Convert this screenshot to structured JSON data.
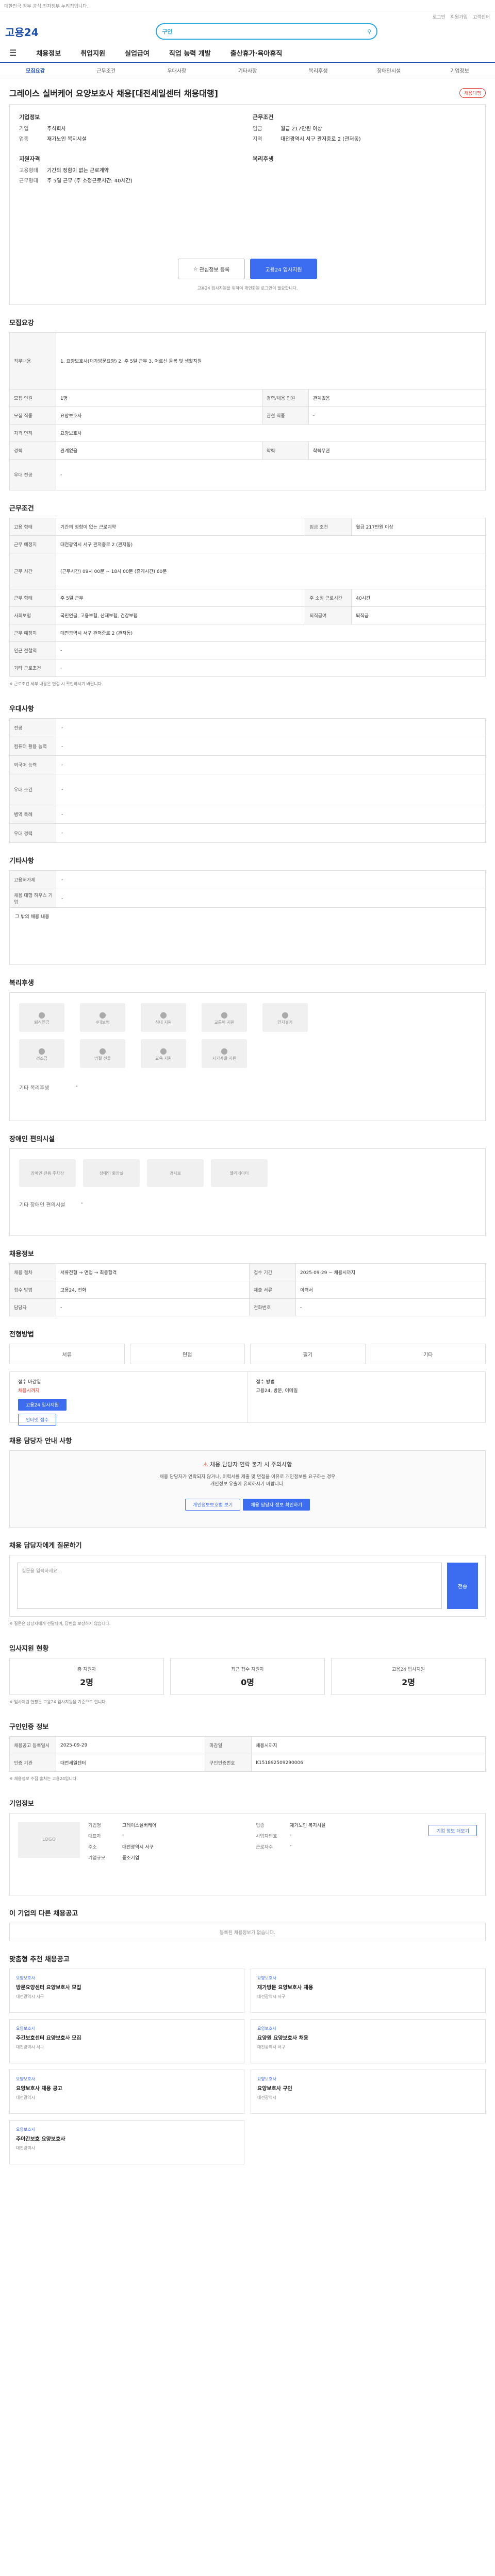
{
  "topbar": {
    "notice": "대한민국 정부 공식 전자정부 누리집입니다."
  },
  "util": {
    "links": [
      "로그인",
      "회원가입",
      "고객센터"
    ]
  },
  "header": {
    "logo": "고용24",
    "search_tag": "구인"
  },
  "nav": {
    "items": [
      "채용정보",
      "취업지원",
      "실업급여",
      "직업 능력 개발",
      "출산휴가·육아휴직"
    ]
  },
  "subnav": {
    "items": [
      "모집요강",
      "근무조건",
      "우대사항",
      "기타사항",
      "복리후생",
      "장애인시설",
      "기업정보"
    ]
  },
  "job": {
    "title": "그레이스 실버케어 요양보호사 채용[대전세일센터 채용대행]",
    "badge": "채용대행",
    "company_h": "기업정보",
    "company_rows": [
      {
        "k": "기업",
        "v": "주식회사"
      },
      {
        "k": "업종",
        "v": "재가노인 복지시설"
      }
    ],
    "cond_h": "근무조건",
    "cond_rows": [
      {
        "k": "임금",
        "v": "월급 217만원 이상"
      },
      {
        "k": "지역",
        "v": "대전광역시 서구 관저중로 2 (관저동)"
      }
    ],
    "qual_h": "지원자격",
    "qual_rows": [
      {
        "k": "고용형태",
        "v": "기간의 정함이 없는 근로계약"
      },
      {
        "k": "근무형태",
        "v": "주 5일 근무 (주 소정근로시간: 40시간)"
      }
    ],
    "welf_h": "복리후생",
    "btn_scrap": "관심정보 등록",
    "btn_apply": "고용24 입사지원",
    "note": "고용24 입사지원을 위하여 개인회원 로그인이 필요합니다."
  },
  "recruit": {
    "title": "모집요강",
    "rows": [
      {
        "k": "직무내용",
        "v": "1. 요양보호사(재가방문요양) 2. 주 5일 근무 3. 어르신 돌봄 및 생활지원"
      },
      {
        "k": "모집 인원",
        "v": "1명",
        "k2": "경력/채용 인원",
        "v2": "관계없음"
      },
      {
        "k": "모집 직종",
        "v": "요양보호사",
        "k2": "관련 직종",
        "v2": "-"
      },
      {
        "k": "자격 면허",
        "v": "요양보호사"
      },
      {
        "k": "경력",
        "v": "관계없음",
        "k2": "학력",
        "v2": "학력무관"
      },
      {
        "k": "우대 전공",
        "v": "-"
      }
    ]
  },
  "work": {
    "title": "근무조건",
    "rows": [
      {
        "k": "고용 형태",
        "v": "기간의 정함이 없는 근로계약",
        "k2": "임금 조건",
        "v2": "월급 217만원 이상"
      },
      {
        "k": "근무 예정지",
        "v": "대전광역시 서구 관저중로 2 (관저동)"
      },
      {
        "k": "근무 시간",
        "v": "(근무시간) 09시 00분 ~ 18시 00분 (휴게시간) 60분"
      },
      {
        "k": "근무 형태",
        "v": "주 5일 근무",
        "k2": "주 소정 근로시간",
        "v2": "40시간"
      },
      {
        "k": "사회보험",
        "v": "국민연금, 고용보험, 산재보험, 건강보험",
        "k2": "퇴직급여",
        "v2": "퇴직금"
      },
      {
        "k": "근무 예정지",
        "v": "대전광역시 서구 관저중로 2 (관저동)"
      },
      {
        "k": "인근 전철역",
        "v": "-"
      },
      {
        "k": "기타 근로조건",
        "v": "-"
      }
    ],
    "note": "※ 근로조건 세부 내용은 면접 시 확인하시기 바랍니다."
  },
  "pref": {
    "title": "우대사항",
    "rows": [
      {
        "k": "전공",
        "v": "-"
      },
      {
        "k": "컴퓨터 활용 능력",
        "v": "-"
      },
      {
        "k": "외국어 능력",
        "v": "-"
      },
      {
        "k": "우대 조건",
        "v": "-"
      },
      {
        "k": "병역 특례",
        "v": "-"
      },
      {
        "k": "우대 경력",
        "v": "-"
      }
    ]
  },
  "etc": {
    "title": "기타사항",
    "rows": [
      {
        "k": "고용허가제",
        "v": "-"
      },
      {
        "k": "채용 대행 하우스 기업",
        "v": "-"
      },
      {
        "k": "그 밖의 채용 내용",
        "v": "-"
      }
    ]
  },
  "welfare": {
    "title": "복리후생",
    "items": [
      "퇴직연금",
      "4대보험",
      "식대 지원",
      "교통비 지원",
      "연차휴가",
      "경조금",
      "명절 선물",
      "교육 지원",
      "자기계발 지원"
    ],
    "extra_k": "기타 복리후생",
    "extra_v": "-"
  },
  "disability": {
    "title": "장애인 편의시설",
    "items": [
      "장애인 전용 주차장",
      "장애인 화장실",
      "경사로",
      "엘리베이터"
    ],
    "extra_k": "기타 장애인 편의시설",
    "extra_v": "-"
  },
  "jobinfo": {
    "title": "채용정보",
    "rows": [
      {
        "k": "채용 절차",
        "v": "서류전형 → 면접 → 최종합격",
        "k2": "접수 기간",
        "v2": "2025-09-29 ~ 채용시까지"
      },
      {
        "k": "접수 방법",
        "v": "고용24, 전화",
        "k2": "제출 서류",
        "v2": "이력서"
      },
      {
        "k": "담당자",
        "v": "-",
        "k2": "전화번호",
        "v2": "-"
      }
    ]
  },
  "apply": {
    "title": "전형방법",
    "tabs": [
      "서류",
      "면접",
      "필기",
      "기타"
    ],
    "left_h": "접수 마감일",
    "left_v": "채용시까지",
    "left_btn": "고용24 입사지원",
    "left_btn2": "인터넷 접수",
    "right_h": "접수 방법",
    "right_v": "고용24, 방문, 이메일"
  },
  "warn": {
    "title": "채용 담당자 안내 사항",
    "heading": "채용 담당자 연락 불가 시 주의사항",
    "lines": [
      "채용 담당자가 연락되지 않거나, 이력서를 제출 및 면접을 이유로 개인정보를 요구하는 경우",
      "개인정보 유출에 유의하시기 바랍니다."
    ],
    "btn1": "개인정보보호법 보기",
    "btn2": "채용 담당자 정보 확인하기"
  },
  "inquiry": {
    "title": "채용 담당자에게 질문하기",
    "placeholder": "질문을 입력하세요.",
    "send": "전송",
    "notes": [
      "※ 질문은 담당자에게 전달되며, 답변을 보장하지 않습니다."
    ]
  },
  "stats": {
    "title": "입사지원 현황",
    "items": [
      {
        "k": "총 지원자",
        "v": "2명"
      },
      {
        "k": "최근 접수 지원자",
        "v": "0명"
      },
      {
        "k": "고용24 입사지원",
        "v": "2명"
      }
    ],
    "note": "※ 입사지원 현황은 고용24 입사지원을 기준으로 합니다."
  },
  "regist": {
    "title": "구인인증 정보",
    "rows": [
      {
        "k": "채용공고 등록일시",
        "v": "2025-09-29",
        "k2": "마감일",
        "v2": "채용시까지"
      },
      {
        "k": "인증 기관",
        "v": "대전세일센터",
        "k2": "구인인증번호",
        "v2": "K151892509290006"
      }
    ],
    "note": "※ 채용정보 수집 출처는 고용24입니다."
  },
  "company": {
    "title": "기업정보",
    "logo": "LOGO",
    "rows": [
      {
        "k": "기업명",
        "v": "그레이스실버케어",
        "k2": "업종",
        "v2": "재가노인 복지시설"
      },
      {
        "k": "대표자",
        "v": "-",
        "k2": "사업자번호",
        "v2": "-"
      },
      {
        "k": "주소",
        "v": "대전광역시 서구",
        "k2": "근로자수",
        "v2": "-"
      },
      {
        "k": "기업규모",
        "v": "중소기업"
      }
    ],
    "btn": "기업 정보 더보기"
  },
  "other": {
    "title": "이 기업의 다른 채용공고",
    "empty": "등록된 채용정보가 없습니다."
  },
  "recs": {
    "title": "맞춤형 추천 채용공고",
    "cards": [
      {
        "tag": "요양보호사",
        "title": "방문요양센터 요양보호사 모집",
        "meta": "대전광역시 서구"
      },
      {
        "tag": "요양보호사",
        "title": "재가방문 요양보호사 채용",
        "meta": "대전광역시 서구"
      },
      {
        "tag": "요양보호사",
        "title": "주간보호센터 요양보호사 모집",
        "meta": "대전광역시 서구"
      },
      {
        "tag": "요양보호사",
        "title": "요양원 요양보호사 채용",
        "meta": "대전광역시 서구"
      },
      {
        "tag": "요양보호사",
        "title": "요양보호사 채용 공고",
        "meta": "대전광역시"
      },
      {
        "tag": "요양보호사",
        "title": "요양보호사 구인",
        "meta": "대전광역시"
      },
      {
        "tag": "요양보호사",
        "title": "주야간보호 요양보호사",
        "meta": "대전광역시"
      }
    ]
  }
}
